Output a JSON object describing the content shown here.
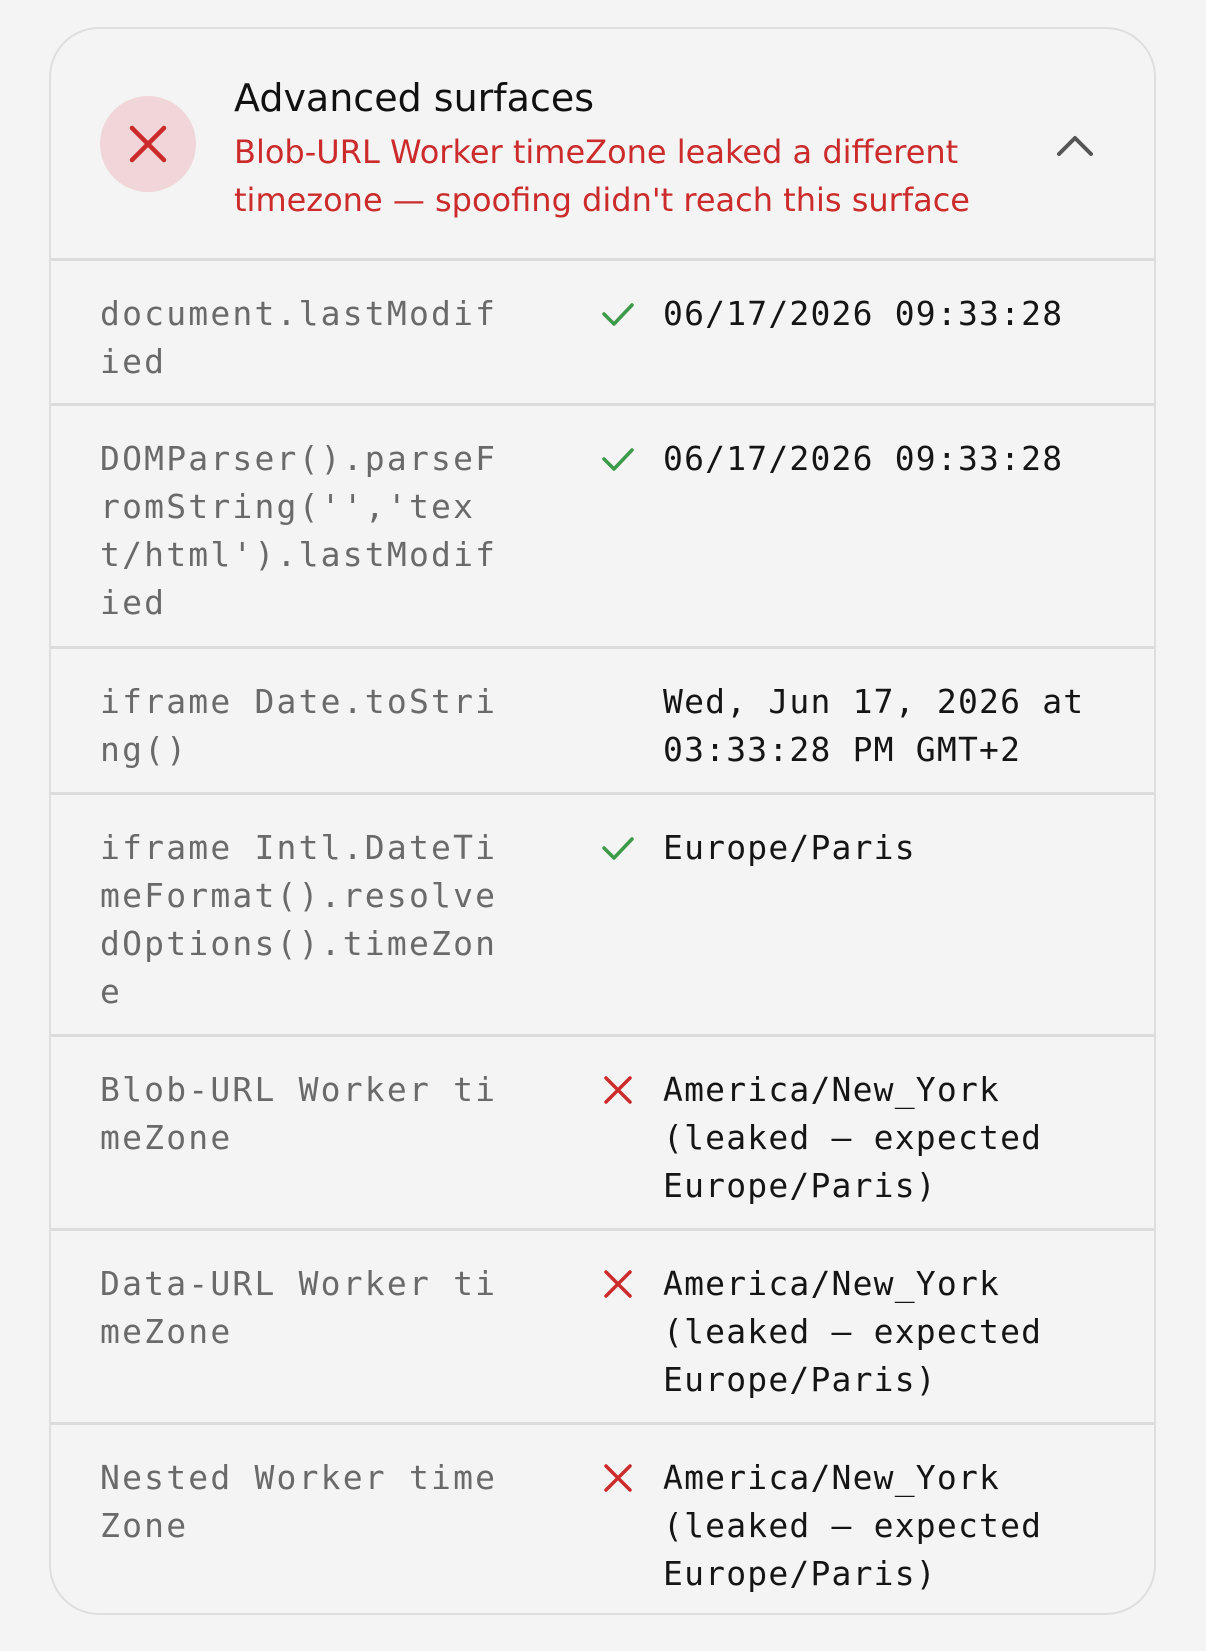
{
  "panel": {
    "title": "Advanced surfaces",
    "status_icon": "close-icon",
    "status_color": "#cc2b2b",
    "subtitle": "Blob-URL Worker timeZone leaked a different timezone — spoofing didn't reach this surface",
    "toggle_icon": "chevron-up-icon"
  },
  "rows": [
    {
      "label": "document.lastModified",
      "status": "pass",
      "value": "06/17/2026 09:33:28"
    },
    {
      "label": "DOMParser().parseFromString('','text/html').lastModified",
      "status": "pass",
      "value": "06/17/2026 09:33:28"
    },
    {
      "label": "iframe Date.toString()",
      "status": "none",
      "value": "Wed, Jun 17, 2026 at 03:33:28 PM GMT+2"
    },
    {
      "label": "iframe Intl.DateTimeFormat().resolvedOptions().timeZone",
      "status": "pass",
      "value": "Europe/Paris"
    },
    {
      "label": "Blob-URL Worker timeZone",
      "status": "fail",
      "value": "America/New_York (leaked — expected Europe/Paris)"
    },
    {
      "label": "Data-URL Worker timeZone",
      "status": "fail",
      "value": "America/New_York (leaked — expected Europe/Paris)"
    },
    {
      "label": "Nested Worker timeZone",
      "status": "fail",
      "value": "America/New_York (leaked — expected Europe/Paris)"
    }
  ],
  "colors": {
    "pass": "#3c9a48",
    "fail": "#cc2b2b"
  }
}
